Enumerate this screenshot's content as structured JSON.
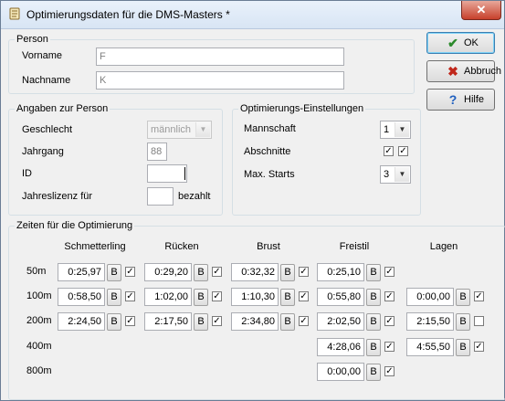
{
  "window": {
    "title": "Optimierungsdaten für die DMS-Masters *",
    "icon": "scroll-icon",
    "close_label": "✕"
  },
  "buttons": {
    "ok": "OK",
    "cancel": "Abbruch",
    "help": "Hilfe"
  },
  "person": {
    "legend": "Person",
    "firstname_label": "Vorname",
    "firstname_value": "F",
    "lastname_label": "Nachname",
    "lastname_value": "K"
  },
  "details": {
    "legend": "Angaben zur Person",
    "gender_label": "Geschlecht",
    "gender_value": "männlich",
    "year_label": "Jahrgang",
    "year_value": "88",
    "id_label": "ID",
    "id_value": "",
    "license_label": "Jahreslizenz für",
    "license_value": "",
    "license_suffix": "bezahlt"
  },
  "settings": {
    "legend": "Optimierungs-Einstellungen",
    "team_label": "Mannschaft",
    "team_value": "1",
    "sections_label": "Abschnitte",
    "sections_checks": [
      true,
      true
    ],
    "maxstarts_label": "Max. Starts",
    "maxstarts_value": "3"
  },
  "times": {
    "legend": "Zeiten für die Optimierung",
    "b_label": "B",
    "columns": [
      "Schmetterling",
      "Rücken",
      "Brust",
      "Freistil",
      "Lagen"
    ],
    "rows": [
      {
        "label": "50m",
        "cells": [
          {
            "time": "0:25,97",
            "checked": true
          },
          {
            "time": "0:29,20",
            "checked": true
          },
          {
            "time": "0:32,32",
            "checked": true
          },
          {
            "time": "0:25,10",
            "checked": true
          },
          null
        ]
      },
      {
        "label": "100m",
        "cells": [
          {
            "time": "0:58,50",
            "checked": true
          },
          {
            "time": "1:02,00",
            "checked": true
          },
          {
            "time": "1:10,30",
            "checked": true
          },
          {
            "time": "0:55,80",
            "checked": true
          },
          {
            "time": "0:00,00",
            "checked": true
          }
        ]
      },
      {
        "label": "200m",
        "cells": [
          {
            "time": "2:24,50",
            "checked": true
          },
          {
            "time": "2:17,50",
            "checked": true
          },
          {
            "time": "2:34,80",
            "checked": true
          },
          {
            "time": "2:02,50",
            "checked": true
          },
          {
            "time": "2:15,50",
            "checked": false
          }
        ]
      },
      {
        "label": "400m",
        "cells": [
          null,
          null,
          null,
          {
            "time": "4:28,06",
            "checked": true
          },
          {
            "time": "4:55,50",
            "checked": true
          }
        ]
      },
      {
        "label": "800m",
        "cells": [
          null,
          null,
          null,
          {
            "time": "0:00,00",
            "checked": true
          },
          null
        ]
      }
    ]
  }
}
